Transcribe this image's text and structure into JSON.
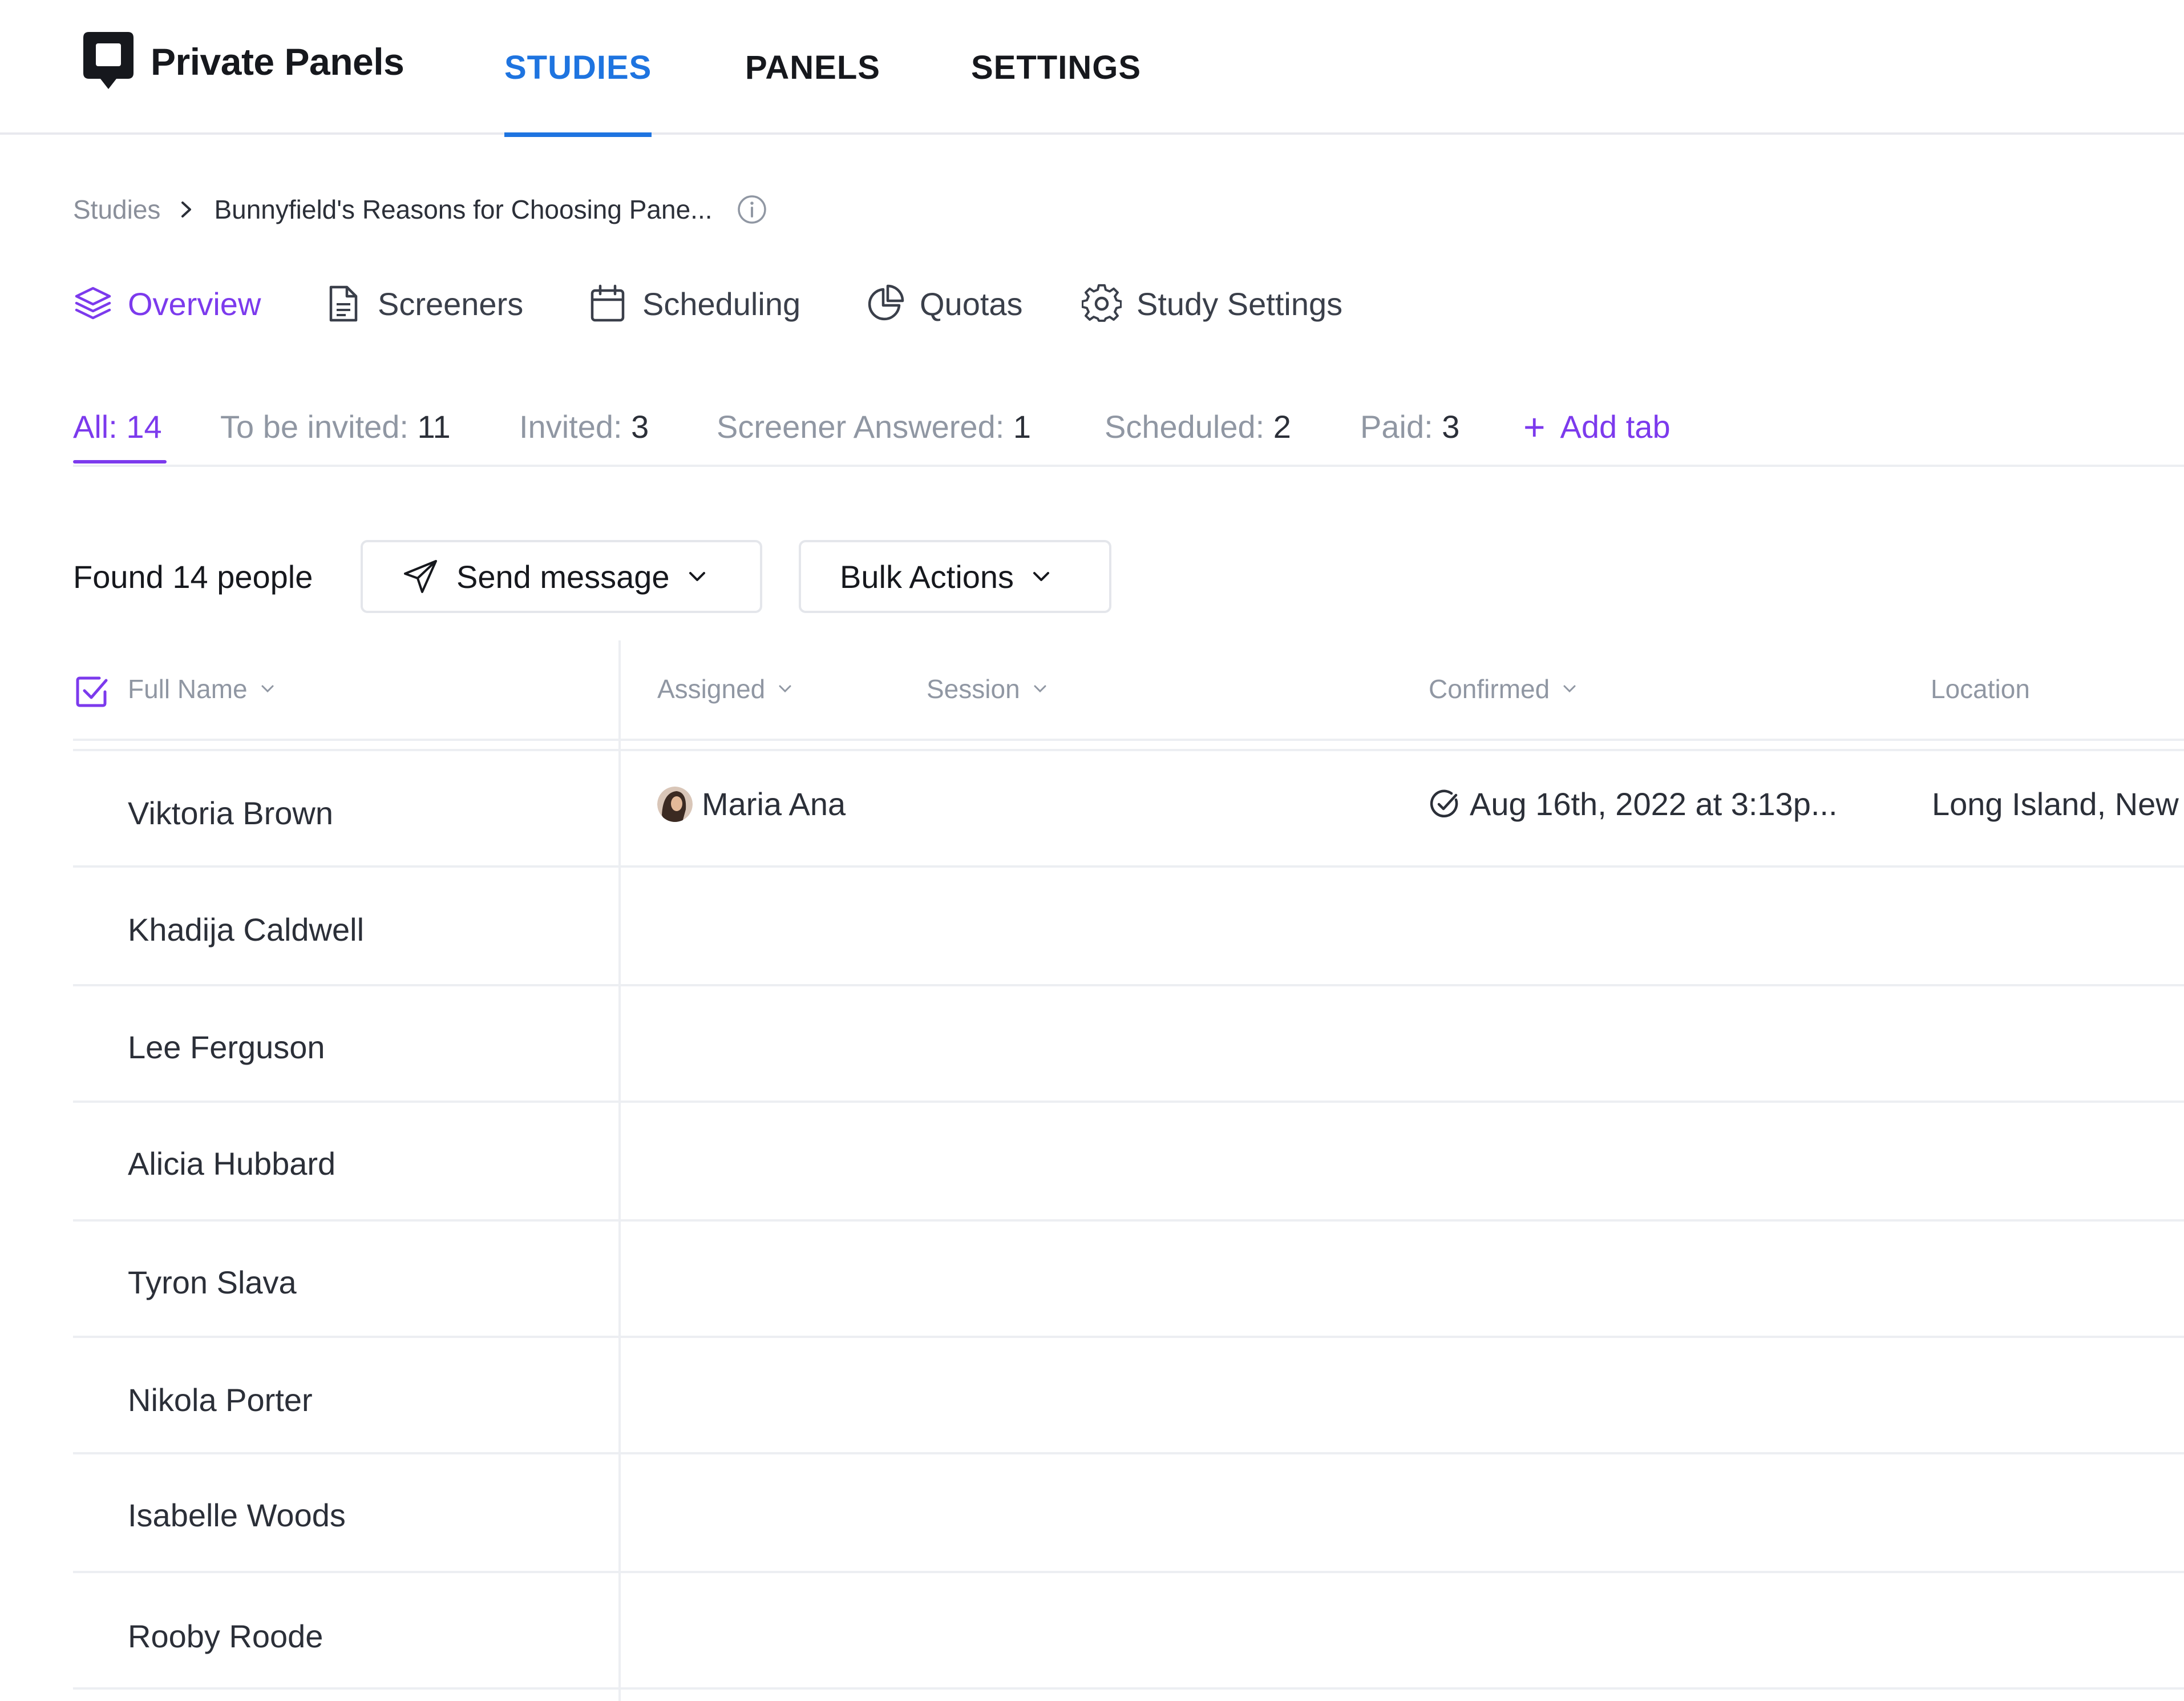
{
  "app": {
    "name": "Private Panels"
  },
  "topnav": [
    {
      "label": "STUDIES",
      "active": true
    },
    {
      "label": "PANELS",
      "active": false
    },
    {
      "label": "SETTINGS",
      "active": false
    }
  ],
  "breadcrumb": {
    "root": "Studies",
    "current": "Bunnyfield's Reasons for Choosing Pane..."
  },
  "subnav": [
    {
      "label": "Overview",
      "icon": "layers-icon",
      "active": true
    },
    {
      "label": "Screeners",
      "icon": "document-icon"
    },
    {
      "label": "Scheduling",
      "icon": "calendar-icon"
    },
    {
      "label": "Quotas",
      "icon": "pie-chart-icon"
    },
    {
      "label": "Study Settings",
      "icon": "gear-icon"
    }
  ],
  "filters": [
    {
      "label": "All:",
      "count": "14",
      "active": true
    },
    {
      "label": "To be invited:",
      "count": "11"
    },
    {
      "label": "Invited:",
      "count": "3"
    },
    {
      "label": "Screener Answered:",
      "count": "1"
    },
    {
      "label": "Scheduled:",
      "count": "2"
    },
    {
      "label": "Paid:",
      "count": "3"
    }
  ],
  "add_tab": "Add tab",
  "toolbar": {
    "found": "Found 14 people",
    "send_message": "Send message",
    "bulk_actions": "Bulk Actions"
  },
  "table": {
    "columns": {
      "full_name": "Full Name",
      "assigned": "Assigned",
      "session": "Session",
      "confirmed": "Confirmed",
      "location": "Location"
    },
    "rows": [
      {
        "name": "Viktoria Brown",
        "assigned": "Maria Ana",
        "confirmed": "Aug 16th, 2022 at 3:13p...",
        "location": "Long Island, New"
      },
      {
        "name": "Khadija Caldwell"
      },
      {
        "name": "Lee Ferguson"
      },
      {
        "name": "Alicia Hubbard"
      },
      {
        "name": "Tyron Slava"
      },
      {
        "name": "Nikola Porter"
      },
      {
        "name": "Isabelle Woods"
      },
      {
        "name": "Rooby Roode"
      }
    ]
  },
  "colors": {
    "primary_blue": "#1e74e0",
    "accent_purple": "#7c3aed"
  }
}
